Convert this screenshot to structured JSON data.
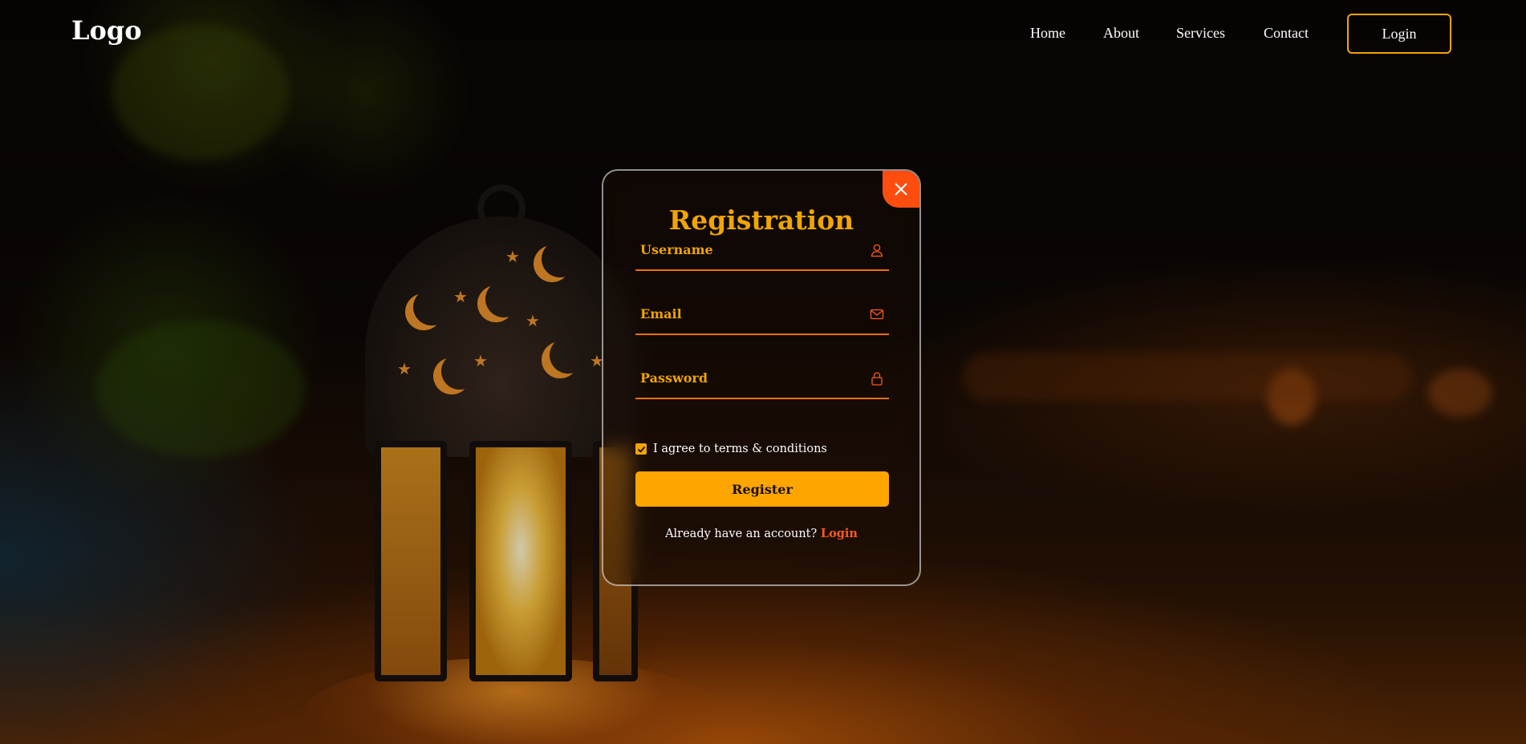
{
  "header": {
    "logo": "Logo",
    "nav": [
      {
        "label": "Home"
      },
      {
        "label": "About"
      },
      {
        "label": "Services"
      },
      {
        "label": "Contact"
      }
    ],
    "login_button": "Login"
  },
  "card": {
    "title": "Registration",
    "fields": {
      "username": {
        "placeholder": "Username",
        "value": "",
        "icon": "user-icon"
      },
      "email": {
        "placeholder": "Email",
        "value": "",
        "icon": "mail-icon"
      },
      "password": {
        "placeholder": "Password",
        "value": "",
        "icon": "lock-icon"
      }
    },
    "agree_checked": true,
    "agree_text": "I agree to terms & conditions",
    "register_button": "Register",
    "footer_question": "Already have an account?",
    "footer_link": "Login",
    "close_icon": "close-icon"
  },
  "colors": {
    "accent": "#f0a500",
    "close_bg": "#ff4d10",
    "field_line": "#f0700a",
    "link": "#ff5a1a"
  }
}
